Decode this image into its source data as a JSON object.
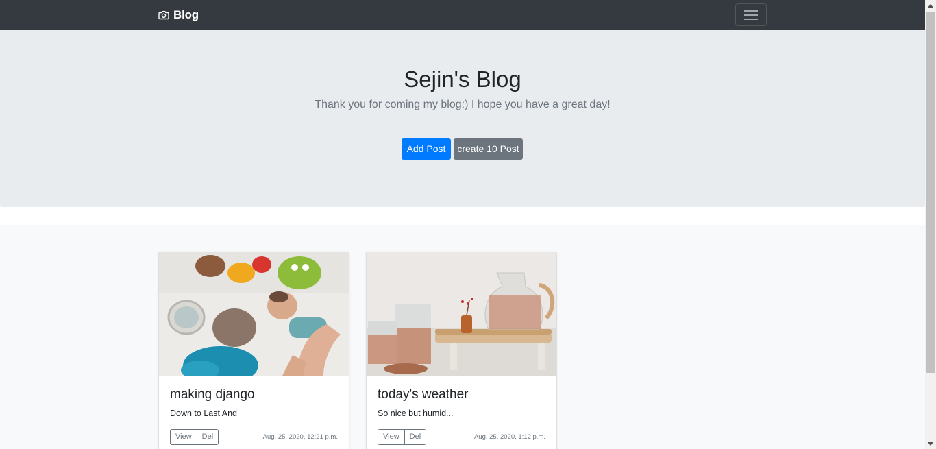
{
  "navbar": {
    "brand_icon": "camera-icon",
    "brand_label": "Blog",
    "menu_icon": "hamburger-menu-icon"
  },
  "jumbotron": {
    "title": "Sejin's Blog",
    "lead": "Thank you for coming my blog:) I hope you have a great day!",
    "add_post_label": "Add Post",
    "create_post_label": "create 10 Post"
  },
  "posts": [
    {
      "title": "making django",
      "text": "Down to Last And",
      "view_label": "View",
      "del_label": "Del",
      "date": "Aug. 25, 2020, 12:21 p.m."
    },
    {
      "title": "today's weather",
      "text": "So nice but humid...",
      "view_label": "View",
      "del_label": "Del",
      "date": "Aug. 25, 2020, 1:12 p.m."
    }
  ],
  "colors": {
    "navbar": "#343a40",
    "jumbotron": "#e9ecef",
    "primary": "#007bff",
    "secondary": "#6c757d"
  }
}
